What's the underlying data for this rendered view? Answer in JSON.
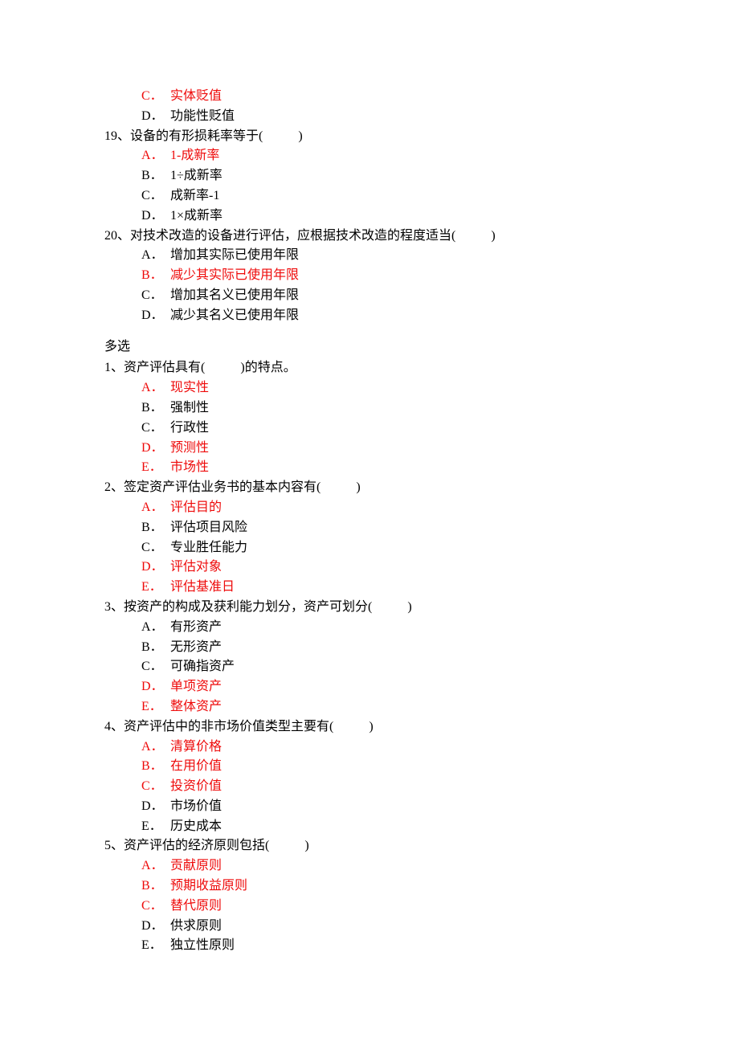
{
  "preOptions": [
    {
      "label": "C．",
      "text": "实体贬值",
      "red": true
    },
    {
      "label": "D．",
      "text": "功能性贬值",
      "red": false
    }
  ],
  "questions": [
    {
      "number": "19、",
      "stem_before": "设备的有形损耗率等于(",
      "stem_after": ")",
      "options": [
        {
          "label": "A．",
          "text": "1-成新率",
          "red": true
        },
        {
          "label": "B．",
          "text": "1÷成新率",
          "red": false
        },
        {
          "label": "C．",
          "text": "成新率-1",
          "red": false
        },
        {
          "label": "D．",
          "text": "1×成新率",
          "red": false
        }
      ]
    },
    {
      "number": "20、",
      "stem_before": "对技术改造的设备进行评估，应根据技术改造的程度适当(",
      "stem_after": ")",
      "options": [
        {
          "label": "A．",
          "text": "增加其实际已使用年限",
          "red": false
        },
        {
          "label": "B．",
          "text": "减少其实际已使用年限",
          "red": true
        },
        {
          "label": "C．",
          "text": "增加其名义已使用年限",
          "red": false
        },
        {
          "label": "D．",
          "text": "减少其名义已使用年限",
          "red": false
        }
      ]
    }
  ],
  "sectionHeading": "多选",
  "multiQuestions": [
    {
      "number": "1、",
      "stem_before": "资产评估具有(",
      "stem_after": ")的特点。",
      "options": [
        {
          "label": "A．",
          "text": "现实性",
          "red": true
        },
        {
          "label": "B．",
          "text": "强制性",
          "red": false
        },
        {
          "label": "C．",
          "text": "行政性",
          "red": false
        },
        {
          "label": "D．",
          "text": "预测性",
          "red": true
        },
        {
          "label": "E．",
          "text": "市场性",
          "red": true
        }
      ]
    },
    {
      "number": "2、",
      "stem_before": "签定资产评估业务书的基本内容有(",
      "stem_after": ")",
      "options": [
        {
          "label": "A．",
          "text": "评估目的",
          "red": true
        },
        {
          "label": "B．",
          "text": "评估项目风险",
          "red": false
        },
        {
          "label": "C．",
          "text": "专业胜任能力",
          "red": false
        },
        {
          "label": "D．",
          "text": "评估对象",
          "red": true
        },
        {
          "label": "E．",
          "text": "评估基准日",
          "red": true
        }
      ]
    },
    {
      "number": "3、",
      "stem_before": "按资产的构成及获利能力划分，资产可划分(",
      "stem_after": ")",
      "options": [
        {
          "label": "A．",
          "text": "有形资产",
          "red": false
        },
        {
          "label": "B．",
          "text": "无形资产",
          "red": false
        },
        {
          "label": "C．",
          "text": "可确指资产",
          "red": false
        },
        {
          "label": "D．",
          "text": "单项资产",
          "red": true
        },
        {
          "label": "E．",
          "text": "整体资产",
          "red": true
        }
      ]
    },
    {
      "number": "4、",
      "stem_before": "资产评估中的非市场价值类型主要有(",
      "stem_after": ")",
      "options": [
        {
          "label": "A．",
          "text": "清算价格",
          "red": true
        },
        {
          "label": "B．",
          "text": "在用价值",
          "red": true
        },
        {
          "label": "C．",
          "text": "投资价值",
          "red": true
        },
        {
          "label": "D．",
          "text": "市场价值",
          "red": false
        },
        {
          "label": "E．",
          "text": "历史成本",
          "red": false
        }
      ]
    },
    {
      "number": "5、",
      "stem_before": "资产评估的经济原则包括(",
      "stem_after": ")",
      "options": [
        {
          "label": "A．",
          "text": "贡献原则",
          "red": true
        },
        {
          "label": "B．",
          "text": "预期收益原则",
          "red": true
        },
        {
          "label": "C．",
          "text": "替代原则",
          "red": true
        },
        {
          "label": "D．",
          "text": "供求原则",
          "red": false
        },
        {
          "label": "E．",
          "text": "独立性原则",
          "red": false
        }
      ]
    }
  ]
}
